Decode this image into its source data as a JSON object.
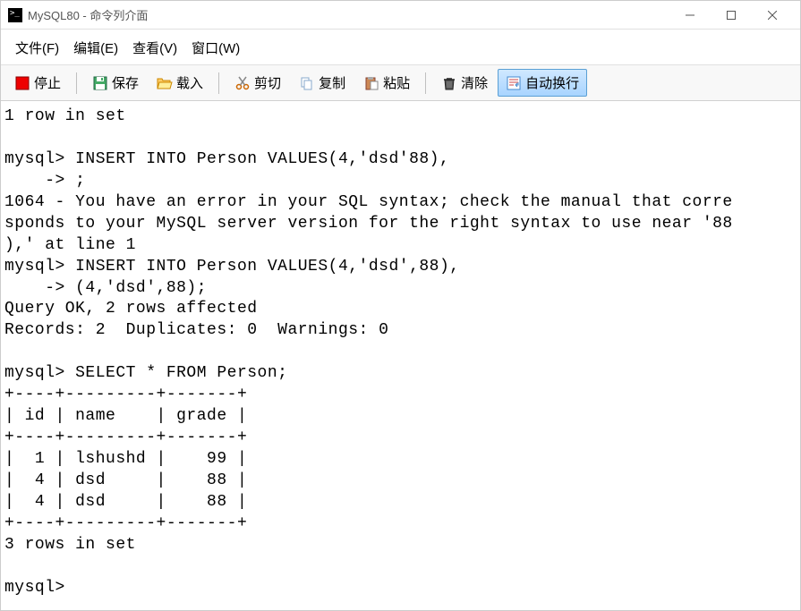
{
  "window": {
    "title": "MySQL80 - 命令列介面"
  },
  "menu": {
    "file": "文件(F)",
    "edit": "编辑(E)",
    "view": "查看(V)",
    "window": "窗口(W)"
  },
  "toolbar": {
    "stop": "停止",
    "save": "保存",
    "load": "载入",
    "cut": "剪切",
    "copy": "复制",
    "paste": "粘贴",
    "clear": "清除",
    "wordwrap": "自动换行"
  },
  "console_text": "1 row in set\n\nmysql> INSERT INTO Person VALUES(4,'dsd'88),\n    -> ;\n1064 - You have an error in your SQL syntax; check the manual that corre\nsponds to your MySQL server version for the right syntax to use near '88\n),' at line 1\nmysql> INSERT INTO Person VALUES(4,'dsd',88),\n    -> (4,'dsd',88);\nQuery OK, 2 rows affected\nRecords: 2  Duplicates: 0  Warnings: 0\n\nmysql> SELECT * FROM Person;\n+----+---------+-------+\n| id | name    | grade |\n+----+---------+-------+\n|  1 | lshushd |    99 |\n|  4 | dsd     |    88 |\n|  4 | dsd     |    88 |\n+----+---------+-------+\n3 rows in set\n\nmysql>"
}
